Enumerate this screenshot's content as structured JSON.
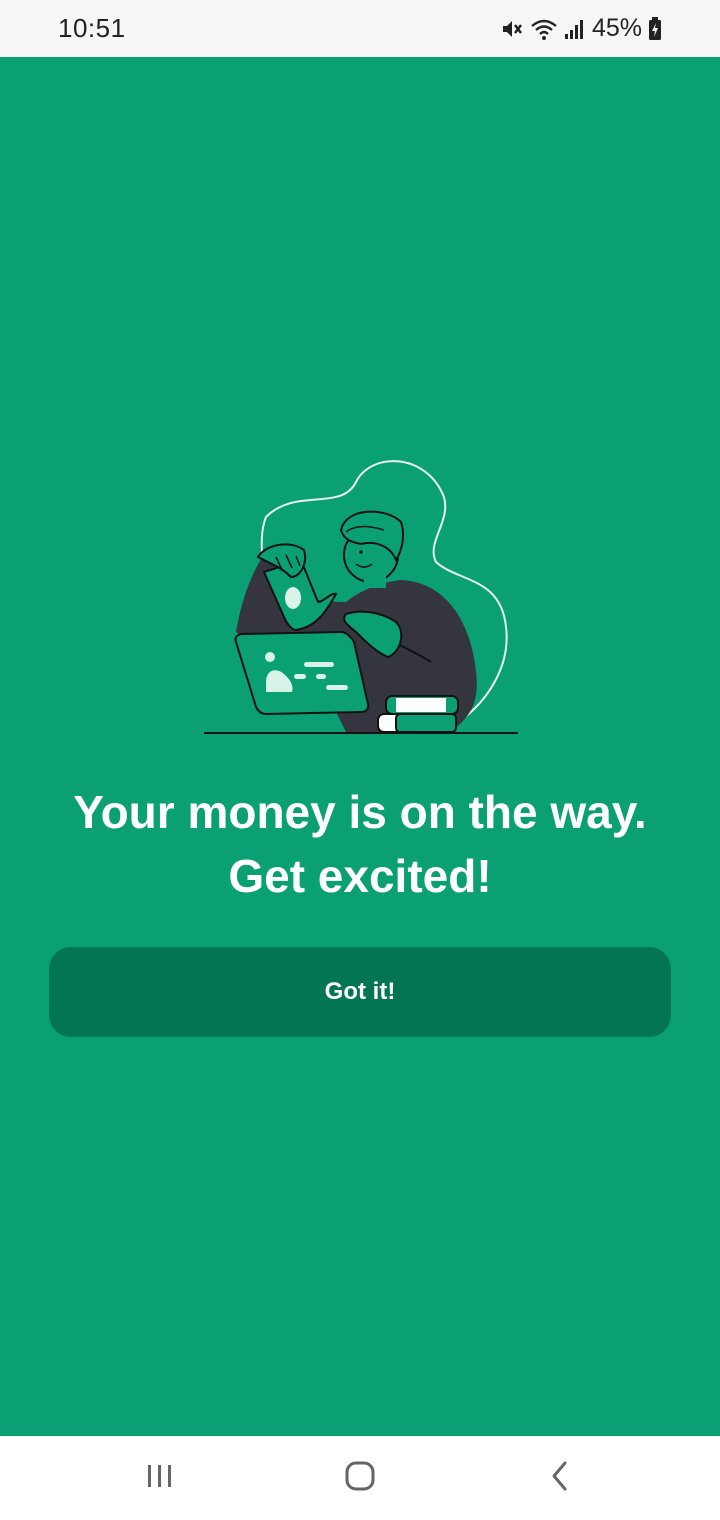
{
  "status_bar": {
    "time": "10:51",
    "battery_percent": "45%",
    "icons": [
      "mute-icon",
      "wifi-icon",
      "signal-icon",
      "battery-charging-icon"
    ]
  },
  "illustration": {
    "icon": "person-receiving-money-illustration"
  },
  "headline": {
    "line1": "Your money is on the way.",
    "line2": "Get excited!"
  },
  "button": {
    "label": "Got it!"
  },
  "nav_bar": {
    "icons": [
      "recent-apps-icon",
      "home-icon",
      "back-icon"
    ]
  },
  "colors": {
    "background": "#0aa074",
    "button": "#047552",
    "text": "#ffffff",
    "illustration_dark": "#353540"
  }
}
